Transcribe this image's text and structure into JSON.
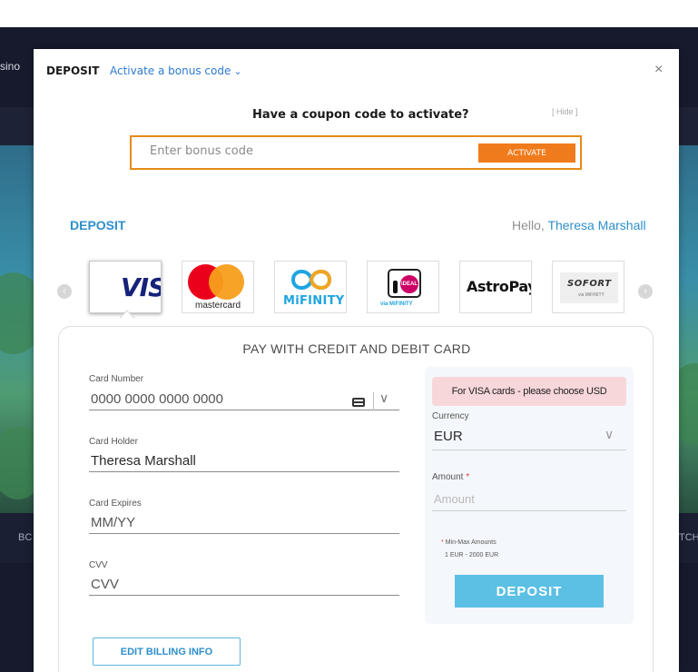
{
  "background": {
    "left_partial_text": "sino",
    "bottom_left_text": "BC",
    "bottom_right_text": "TCH"
  },
  "modal": {
    "title": "DEPOSIT",
    "bonus_link": "Activate a bonus code",
    "bonus_chevron": "⌄",
    "close": "×"
  },
  "coupon": {
    "question": "Have a coupon code to activate?",
    "hide": "[ Hide ]",
    "placeholder": "Enter bonus code",
    "activate": "ACTIVATE"
  },
  "deposit": {
    "heading": "DEPOSIT",
    "hello": "Hello,",
    "user_name": "Theresa Marshall"
  },
  "payment_methods": {
    "prev_icon": "‹",
    "next_icon": "›",
    "items": [
      {
        "id": "visa",
        "brand": "VISA",
        "display": "VIS"
      },
      {
        "id": "mastercard",
        "label": "mastercard"
      },
      {
        "id": "mifinity",
        "label": "MiFINITY"
      },
      {
        "id": "ideal",
        "badge": "iDEAL",
        "sub": "via MiFINITY"
      },
      {
        "id": "astropay",
        "label": "AstroPay"
      },
      {
        "id": "sofort",
        "label": "SOFORT",
        "sub": "via MiFINITY"
      }
    ],
    "selected": "visa"
  },
  "card_form": {
    "title": "PAY WITH CREDIT AND DEBIT CARD",
    "card_number": {
      "label": "Card Number",
      "placeholder": "0000 0000 0000 0000"
    },
    "card_holder": {
      "label": "Card Holder",
      "value": "Theresa Marshall"
    },
    "card_expires": {
      "label": "Card Expires",
      "placeholder": "MM/YY"
    },
    "cvv": {
      "label": "CVV",
      "placeholder": "CVV"
    },
    "edit_billing": "EDIT BILLING INFO"
  },
  "summary": {
    "visa_notice": "For VISA cards - please choose USD",
    "currency_label": "Currency",
    "currency_value": "EUR",
    "amount_label": "Amount",
    "required_mark": "*",
    "amount_placeholder": "Amount",
    "minmax_title": "Min-Max Amounts",
    "minmax_range": "1 EUR - 2000 EUR",
    "deposit_button": "DEPOSIT"
  },
  "colors": {
    "accent_blue": "#2e8fc9",
    "orange": "#f07b1c",
    "deposit_button": "#5bc0e4",
    "notice_bg": "#f8d7da"
  }
}
